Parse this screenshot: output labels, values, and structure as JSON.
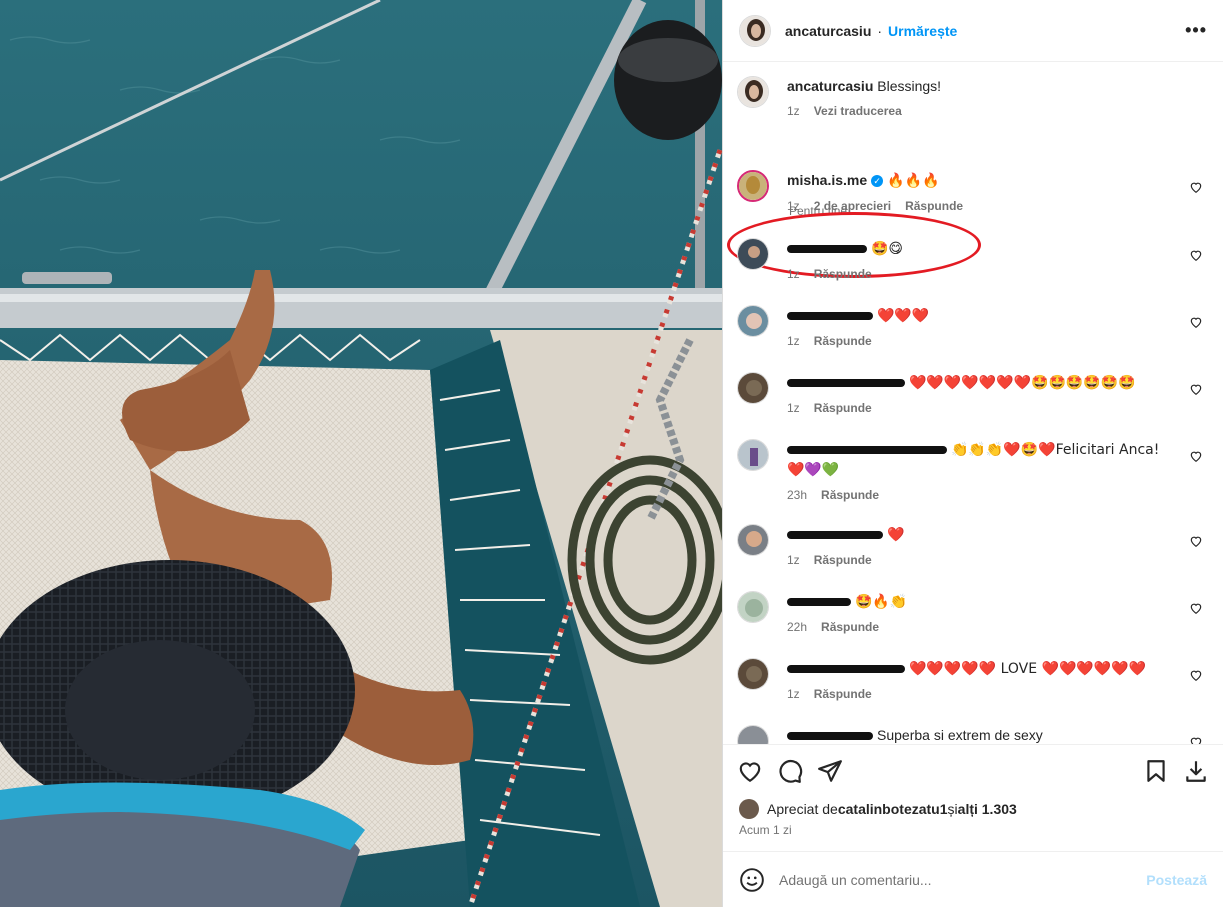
{
  "post": {
    "author": "ancaturcasiu",
    "follow_label": "Urmărește",
    "dot": "·",
    "more": "•••"
  },
  "caption": {
    "user": "ancaturcasiu",
    "text": "Blessings!",
    "time": "1z",
    "translate": "Vezi traducerea"
  },
  "section_label": "Pentru tine",
  "comments": [
    {
      "user": "misha.is.me",
      "verified": true,
      "text": "🔥🔥🔥",
      "time": "1z",
      "likes": "2 de aprecieri",
      "reply": "Răspunde",
      "highlighted": true
    },
    {
      "user": "",
      "redacted_width": 80,
      "text": "🤩😋",
      "time": "1z",
      "reply": "Răspunde"
    },
    {
      "user": "",
      "redacted_width": 86,
      "text": "❤️❤️❤️",
      "time": "1z",
      "reply": "Răspunde"
    },
    {
      "user": "",
      "redacted_width": 118,
      "text": "❤️❤️❤️❤️❤️❤️❤️🤩🤩🤩🤩🤩🤩",
      "time": "1z",
      "reply": "Răspunde"
    },
    {
      "user": "",
      "redacted_width": 160,
      "text": "👏👏👏❤️🤩❤️Felicitari Anca!",
      "text2": "❤️💜💚",
      "time": "23h",
      "reply": "Răspunde"
    },
    {
      "user": "",
      "redacted_width": 96,
      "text": "❤️",
      "time": "1z",
      "reply": "Răspunde"
    },
    {
      "user": "",
      "redacted_width": 64,
      "text": "🤩🔥👏",
      "time": "22h",
      "reply": "Răspunde"
    },
    {
      "user": "",
      "redacted_width": 118,
      "text": "❤️❤️❤️❤️❤️ LOVE ❤️❤️❤️❤️❤️❤️",
      "time": "1z",
      "reply": "Răspunde"
    },
    {
      "user": "",
      "redacted_width": 86,
      "text": "Superba si extrem de sexy",
      "time": "",
      "reply": ""
    }
  ],
  "likes": {
    "prefix": "Apreciat de ",
    "user": "catalinbotezatu1",
    "suffix": " și ",
    "others": "alți 1.303"
  },
  "timestamp": "Acum 1 zi",
  "add_comment": {
    "placeholder": "Adaugă un comentariu...",
    "post_label": "Postează"
  }
}
